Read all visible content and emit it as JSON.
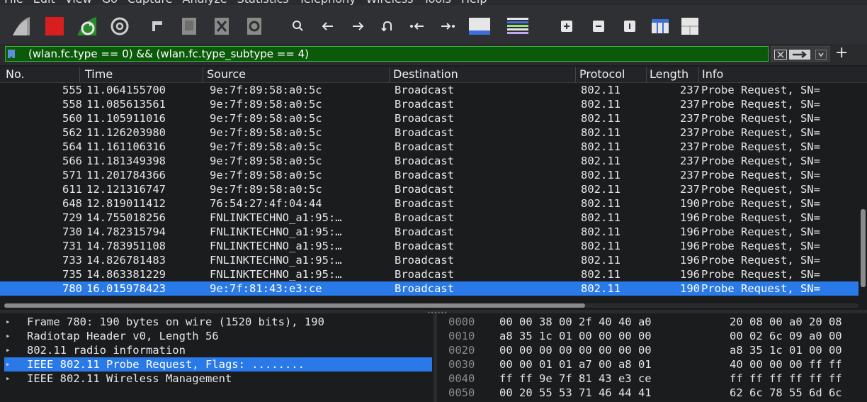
{
  "menu": {
    "items": [
      "File",
      "Edit",
      "View",
      "Go",
      "Capture",
      "Analyze",
      "Statistics",
      "Telephony",
      "Wireless",
      "Tools",
      "Help"
    ]
  },
  "toolbar": {
    "icons": [
      "shark-fin-start-icon",
      "stop-capture-icon",
      "restart-capture-icon",
      "capture-options-icon",
      "open-file-icon",
      "save-file-icon",
      "close-file-icon",
      "reload-file-icon",
      "find-packet-icon",
      "go-back-icon",
      "go-forward-icon",
      "go-to-packet-icon",
      "first-packet-icon",
      "last-packet-icon",
      "auto-scroll-icon",
      "colorize-icon",
      "zoom-in-icon",
      "zoom-out-icon",
      "normal-size-icon",
      "resize-columns-icon",
      "layout-icon"
    ]
  },
  "filter": {
    "expression": "(wlan.fc.type == 0) && (wlan.fc.type_subtype == 4)"
  },
  "columns": {
    "no": "No.",
    "time": "Time",
    "source": "Source",
    "destination": "Destination",
    "protocol": "Protocol",
    "length": "Length",
    "info": "Info"
  },
  "packets": [
    {
      "no": "555",
      "time": "11.064155700",
      "source": "9e:7f:89:58:a0:5c",
      "destination": "Broadcast",
      "protocol": "802.11",
      "length": "237",
      "info": "Probe Request, SN="
    },
    {
      "no": "558",
      "time": "11.085613561",
      "source": "9e:7f:89:58:a0:5c",
      "destination": "Broadcast",
      "protocol": "802.11",
      "length": "237",
      "info": "Probe Request, SN="
    },
    {
      "no": "560",
      "time": "11.105911016",
      "source": "9e:7f:89:58:a0:5c",
      "destination": "Broadcast",
      "protocol": "802.11",
      "length": "237",
      "info": "Probe Request, SN="
    },
    {
      "no": "562",
      "time": "11.126203980",
      "source": "9e:7f:89:58:a0:5c",
      "destination": "Broadcast",
      "protocol": "802.11",
      "length": "237",
      "info": "Probe Request, SN="
    },
    {
      "no": "564",
      "time": "11.161106316",
      "source": "9e:7f:89:58:a0:5c",
      "destination": "Broadcast",
      "protocol": "802.11",
      "length": "237",
      "info": "Probe Request, SN="
    },
    {
      "no": "566",
      "time": "11.181349398",
      "source": "9e:7f:89:58:a0:5c",
      "destination": "Broadcast",
      "protocol": "802.11",
      "length": "237",
      "info": "Probe Request, SN="
    },
    {
      "no": "571",
      "time": "11.201784366",
      "source": "9e:7f:89:58:a0:5c",
      "destination": "Broadcast",
      "protocol": "802.11",
      "length": "237",
      "info": "Probe Request, SN="
    },
    {
      "no": "611",
      "time": "12.121316747",
      "source": "9e:7f:89:58:a0:5c",
      "destination": "Broadcast",
      "protocol": "802.11",
      "length": "237",
      "info": "Probe Request, SN="
    },
    {
      "no": "648",
      "time": "12.819011412",
      "source": "76:54:27:4f:04:44",
      "destination": "Broadcast",
      "protocol": "802.11",
      "length": "190",
      "info": "Probe Request, SN="
    },
    {
      "no": "729",
      "time": "14.755018256",
      "source": "FNLINKTECHNO_a1:95:…",
      "destination": "Broadcast",
      "protocol": "802.11",
      "length": "196",
      "info": "Probe Request, SN="
    },
    {
      "no": "730",
      "time": "14.782315794",
      "source": "FNLINKTECHNO_a1:95:…",
      "destination": "Broadcast",
      "protocol": "802.11",
      "length": "196",
      "info": "Probe Request, SN="
    },
    {
      "no": "731",
      "time": "14.783951108",
      "source": "FNLINKTECHNO_a1:95:…",
      "destination": "Broadcast",
      "protocol": "802.11",
      "length": "196",
      "info": "Probe Request, SN="
    },
    {
      "no": "733",
      "time": "14.826781483",
      "source": "FNLINKTECHNO_a1:95:…",
      "destination": "Broadcast",
      "protocol": "802.11",
      "length": "196",
      "info": "Probe Request, SN="
    },
    {
      "no": "735",
      "time": "14.863381229",
      "source": "FNLINKTECHNO_a1:95:…",
      "destination": "Broadcast",
      "protocol": "802.11",
      "length": "196",
      "info": "Probe Request, SN="
    },
    {
      "no": "780",
      "time": "16.015978423",
      "source": "9e:7f:81:43:e3:ce",
      "destination": "Broadcast",
      "protocol": "802.11",
      "length": "190",
      "info": "Probe Request, SN=",
      "selected": true
    }
  ],
  "details": [
    {
      "text": "Frame 780: 190 bytes on wire (1520 bits), 190",
      "selected": false
    },
    {
      "text": "Radiotap Header v0, Length 56",
      "selected": false
    },
    {
      "text": "802.11 radio information",
      "selected": false
    },
    {
      "text": "IEEE 802.11 Probe Request, Flags: ........",
      "selected": true
    },
    {
      "text": "IEEE 802.11 Wireless Management",
      "selected": false
    }
  ],
  "hex": [
    {
      "offset": "0000",
      "a": "00 00 38 00 2f 40 40 a0",
      "b": "20 08 00 a0 20 08"
    },
    {
      "offset": "0010",
      "a": "a8 35 1c 01 00 00 00 00",
      "b": "00 02 6c 09 a0 00"
    },
    {
      "offset": "0020",
      "a": "00 00 00 00 00 00 00 00",
      "b": "a8 35 1c 01 00 00"
    },
    {
      "offset": "0030",
      "a": "00 00 01 01 a7 00 a8 01",
      "b": "40 00 00 00 ff ff"
    },
    {
      "offset": "0040",
      "a": "ff ff 9e 7f 81 43 e3 ce",
      "b": "ff ff ff ff ff ff"
    },
    {
      "offset": "0050",
      "a": "00 20 55 53 71 46 44 41",
      "b": "62 6c 78 55 6d 6c"
    }
  ],
  "colors": {
    "selection": "#2979e8",
    "filter_ok": "#0b5a0b",
    "background": "#1b1c1e"
  }
}
